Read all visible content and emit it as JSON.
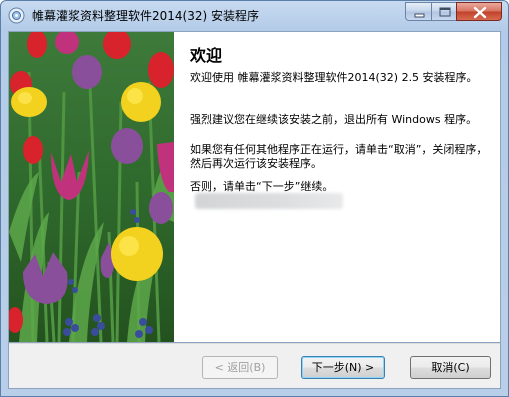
{
  "window": {
    "title": "帷幕灌浆资料整理软件2014(32) 安装程序",
    "controls": {
      "minimize_icon": "minimize-icon",
      "maximize_icon": "maximize-icon",
      "close_icon": "close-icon"
    }
  },
  "banner": {
    "image": "tulip-flowers-image"
  },
  "welcome": {
    "heading": "欢迎",
    "paragraph1": "欢迎使用 帷幕灌浆资料整理软件2014(32) 2.5 安装程序。",
    "paragraph2": "强烈建议您在继续该安装之前，退出所有 Windows 程序。",
    "paragraph3": "如果您有任何其他程序正在运行，请单击“取消”，关闭程序，然后再次运行该安装程序。",
    "paragraph4": "否则，请单击“下一步”继续。"
  },
  "buttons": {
    "back": "< 返回(B)",
    "next": "下一步(N) >",
    "cancel": "取消(C)"
  },
  "colors": {
    "titlebar": "#b9cfe9",
    "close_button": "#c2412a",
    "default_button_border": "#3c7fb1"
  }
}
